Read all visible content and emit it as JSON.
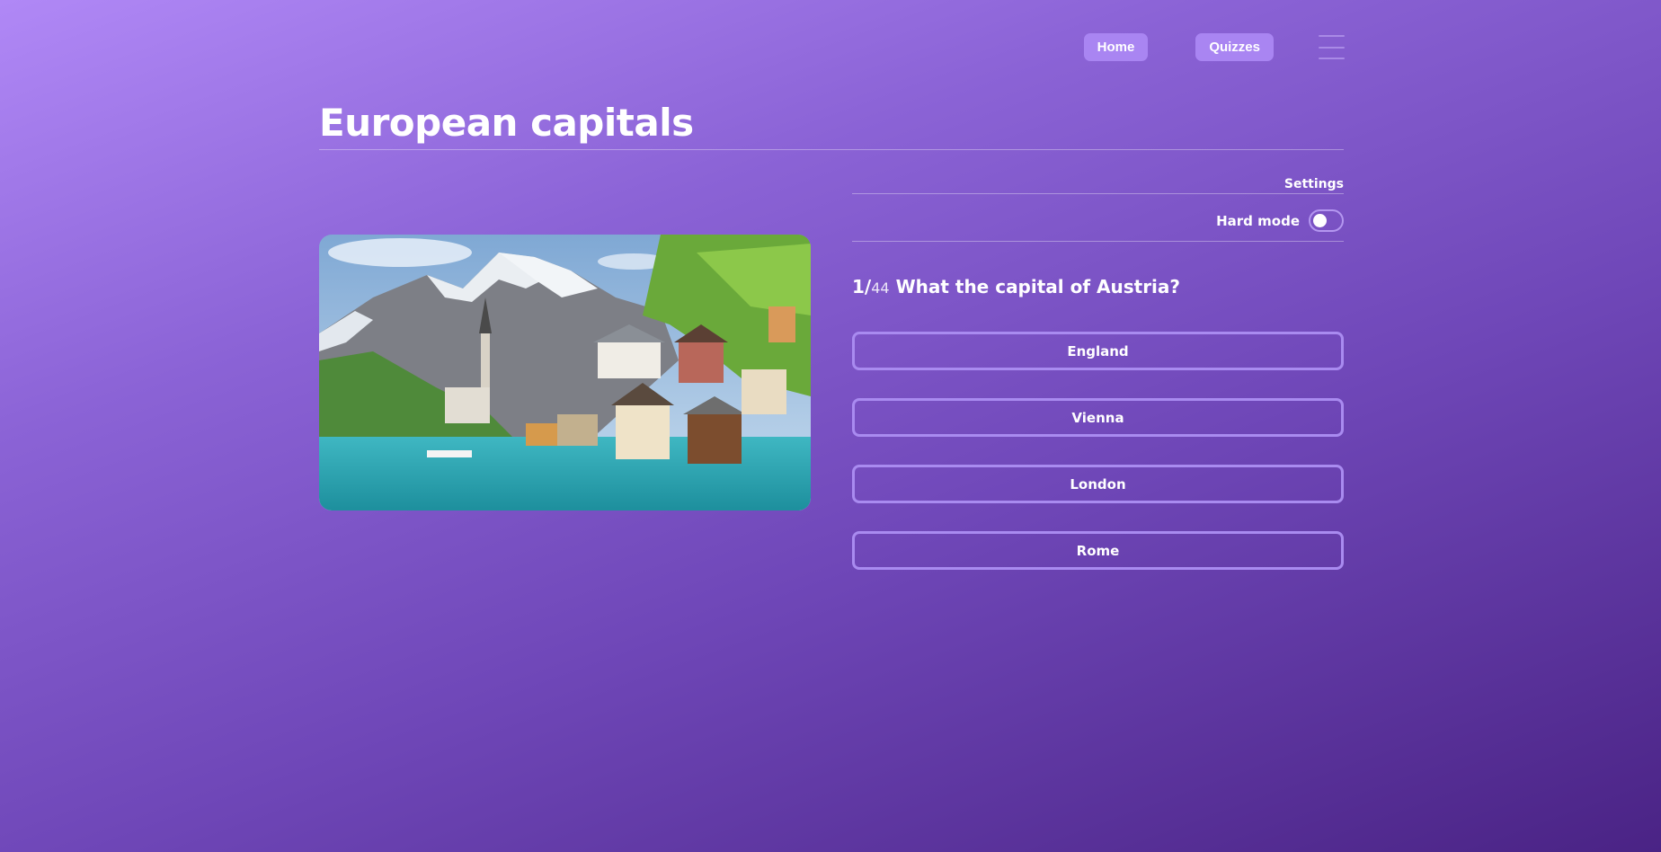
{
  "nav": {
    "home_label": "Home",
    "quizzes_label": "Quizzes",
    "menu_icon": "hamburger-menu-icon"
  },
  "quiz": {
    "title": "European capitals",
    "settings_label": "Settings",
    "hard_mode_label": "Hard mode",
    "hard_mode_enabled": false,
    "question_number": "1/",
    "question_total": "44",
    "question_text": "What the capital of Austria?",
    "answers": [
      "England",
      "Vienna",
      "London",
      "Rome"
    ]
  },
  "colors": {
    "button_bg": "#a985f2",
    "answer_border": "#a98bf0",
    "gradient_start": "#b088f6",
    "gradient_end": "#4a2385"
  }
}
